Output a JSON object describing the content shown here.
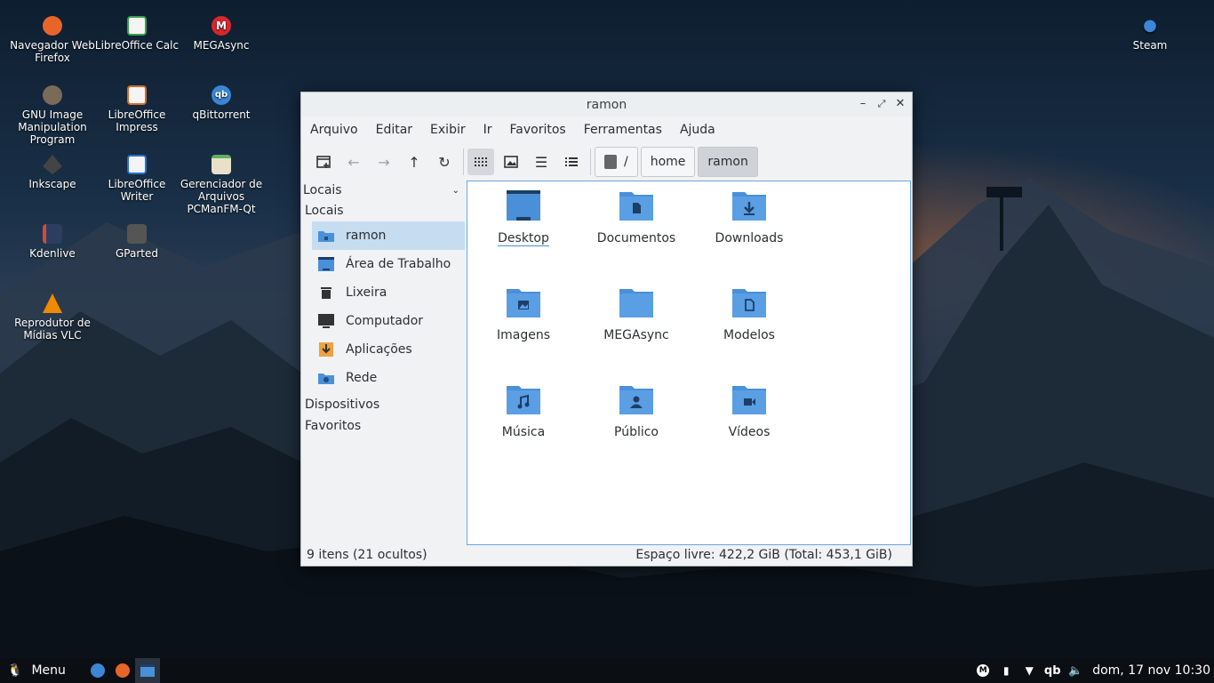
{
  "desktop": {
    "icons": [
      {
        "label": "Navegador Web Firefox",
        "icon": "firefox-icon"
      },
      {
        "label": "LibreOffice Calc",
        "icon": "libreoffice-calc-icon"
      },
      {
        "label": "MEGAsync",
        "icon": "megasync-icon"
      },
      {
        "label": "GNU Image Manipulation Program",
        "icon": "gimp-icon"
      },
      {
        "label": "LibreOffice Impress",
        "icon": "libreoffice-impress-icon"
      },
      {
        "label": "qBittorrent",
        "icon": "qbittorrent-icon"
      },
      {
        "label": "Inkscape",
        "icon": "inkscape-icon"
      },
      {
        "label": "LibreOffice Writer",
        "icon": "libreoffice-writer-icon"
      },
      {
        "label": "Gerenciador de Arquivos PCManFM-Qt",
        "icon": "file-manager-icon"
      },
      {
        "label": "Kdenlive",
        "icon": "kdenlive-icon"
      },
      {
        "label": "GParted",
        "icon": "gparted-icon"
      },
      {
        "label": "Reprodutor de Mídias VLC",
        "icon": "vlc-icon"
      },
      {
        "label": "Steam",
        "icon": "steam-icon"
      }
    ]
  },
  "window": {
    "title": "ramon",
    "menu": [
      "Arquivo",
      "Editar",
      "Exibir",
      "Ir",
      "Favoritos",
      "Ferramentas",
      "Ajuda"
    ],
    "path": {
      "root": "/",
      "segments": [
        "home",
        "ramon"
      ]
    },
    "sidebar": {
      "combo": "Locais",
      "sections": [
        "Locais",
        "Dispositivos",
        "Favoritos"
      ],
      "items": [
        {
          "label": "ramon",
          "icon": "home-folder-icon",
          "selected": true
        },
        {
          "label": "Área de Trabalho",
          "icon": "desktop-icon"
        },
        {
          "label": "Lixeira",
          "icon": "trash-icon"
        },
        {
          "label": "Computador",
          "icon": "computer-icon"
        },
        {
          "label": "Aplicações",
          "icon": "applications-icon"
        },
        {
          "label": "Rede",
          "icon": "network-icon"
        }
      ]
    },
    "files": [
      {
        "name": "Desktop",
        "icon": "desktop-folder-icon"
      },
      {
        "name": "Documentos",
        "icon": "documents-folder-icon"
      },
      {
        "name": "Downloads",
        "icon": "downloads-folder-icon"
      },
      {
        "name": "Imagens",
        "icon": "pictures-folder-icon"
      },
      {
        "name": "MEGAsync",
        "icon": "folder-icon"
      },
      {
        "name": "Modelos",
        "icon": "templates-folder-icon"
      },
      {
        "name": "Música",
        "icon": "music-folder-icon"
      },
      {
        "name": "Público",
        "icon": "public-folder-icon"
      },
      {
        "name": "Vídeos",
        "icon": "videos-folder-icon"
      }
    ],
    "status": {
      "left": "9 itens (21 ocultos)",
      "right": "Espaço livre: 422,2 GiB (Total: 453,1 GiB)"
    }
  },
  "taskbar": {
    "menu_label": "Menu",
    "clock": "dom, 17 nov 10:30",
    "tray_text": "qb"
  }
}
